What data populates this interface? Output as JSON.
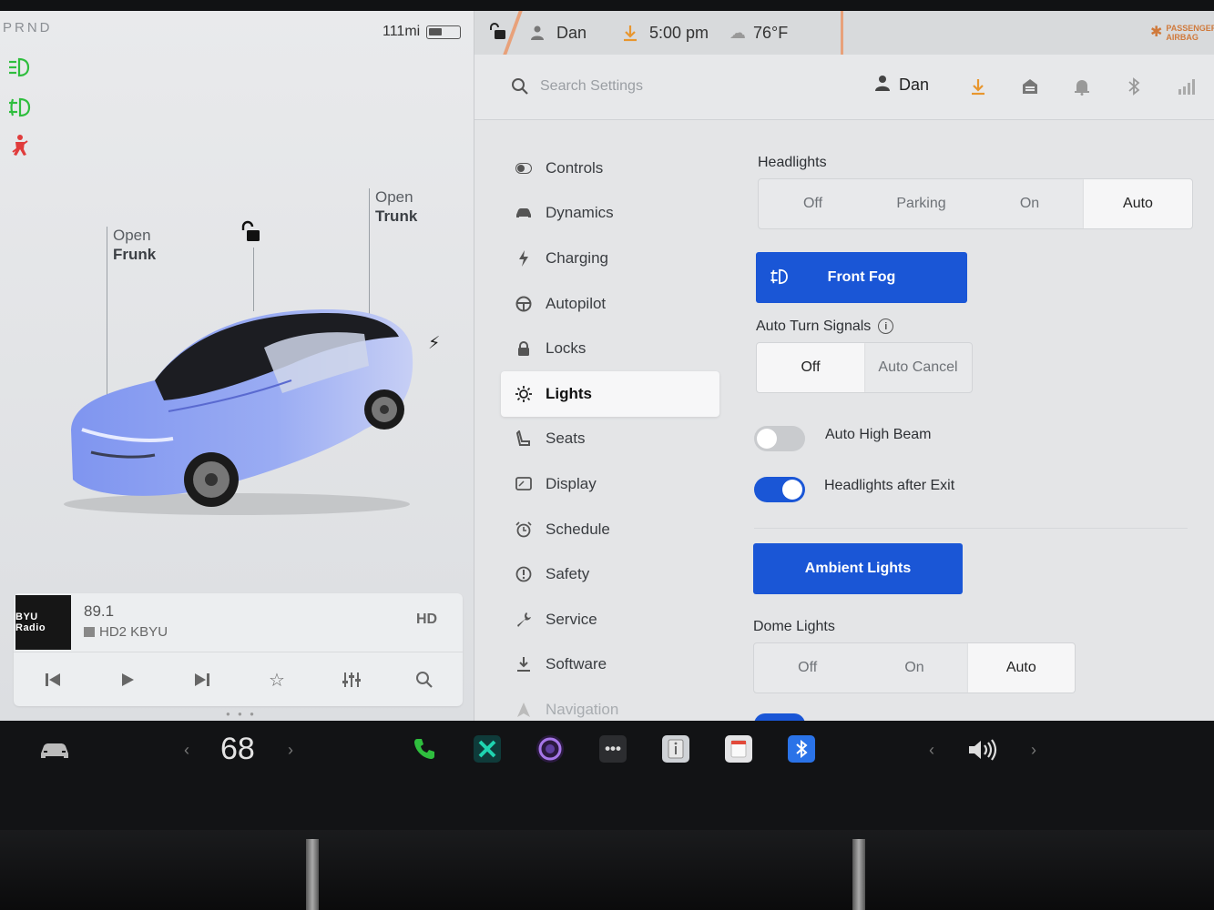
{
  "car": {
    "gear": "PRND",
    "range": "111mi",
    "battery_level": 0.45,
    "frunk_callout": {
      "line1": "Open",
      "line2": "Frunk"
    },
    "trunk_callout": {
      "line1": "Open",
      "line2": "Trunk"
    },
    "car_color": "#8fa3f0"
  },
  "media": {
    "album_label": "BYU Radio",
    "frequency": "89.1",
    "station": "HD2 KBYU"
  },
  "status_bar": {
    "user": "Dan",
    "time": "5:00 pm",
    "temperature": "76°F",
    "airbag_label_1": "PASSENGER",
    "airbag_label_2": "AIRBAG"
  },
  "header": {
    "search_placeholder": "Search Settings",
    "user": "Dan"
  },
  "nav": {
    "items": [
      {
        "label": "Controls",
        "icon": "toggle-icon"
      },
      {
        "label": "Dynamics",
        "icon": "car-icon"
      },
      {
        "label": "Charging",
        "icon": "bolt-icon"
      },
      {
        "label": "Autopilot",
        "icon": "steering-wheel-icon"
      },
      {
        "label": "Locks",
        "icon": "lock-icon"
      },
      {
        "label": "Lights",
        "icon": "sun-icon"
      },
      {
        "label": "Seats",
        "icon": "seat-icon"
      },
      {
        "label": "Display",
        "icon": "display-icon"
      },
      {
        "label": "Schedule",
        "icon": "alarm-clock-icon"
      },
      {
        "label": "Safety",
        "icon": "alert-circle-icon"
      },
      {
        "label": "Service",
        "icon": "wrench-icon"
      },
      {
        "label": "Software",
        "icon": "download-icon"
      },
      {
        "label": "Navigation",
        "icon": "navigation-arrow-icon"
      }
    ],
    "active": "Lights"
  },
  "lights": {
    "headlights_label": "Headlights",
    "headlights_options": [
      "Off",
      "Parking",
      "On",
      "Auto"
    ],
    "headlights_selected": "Auto",
    "front_fog_label": "Front Fog",
    "auto_turn_label": "Auto Turn Signals",
    "auto_turn_options": [
      "Off",
      "Auto Cancel"
    ],
    "auto_turn_selected": "Off",
    "auto_high_beam_label": "Auto High Beam",
    "auto_high_beam_on": false,
    "headlights_after_exit_label": "Headlights after Exit",
    "headlights_after_exit_on": true,
    "ambient_lights_label": "Ambient Lights",
    "dome_lights_label": "Dome Lights",
    "dome_options": [
      "Off",
      "On",
      "Auto"
    ],
    "dome_selected": "Auto"
  },
  "dock": {
    "temperature": "68"
  },
  "colors": {
    "accent": "#1a56d6",
    "indicator_green": "#2fbe3e",
    "indicator_red": "#e03c3c",
    "download_orange": "#e8962e"
  }
}
